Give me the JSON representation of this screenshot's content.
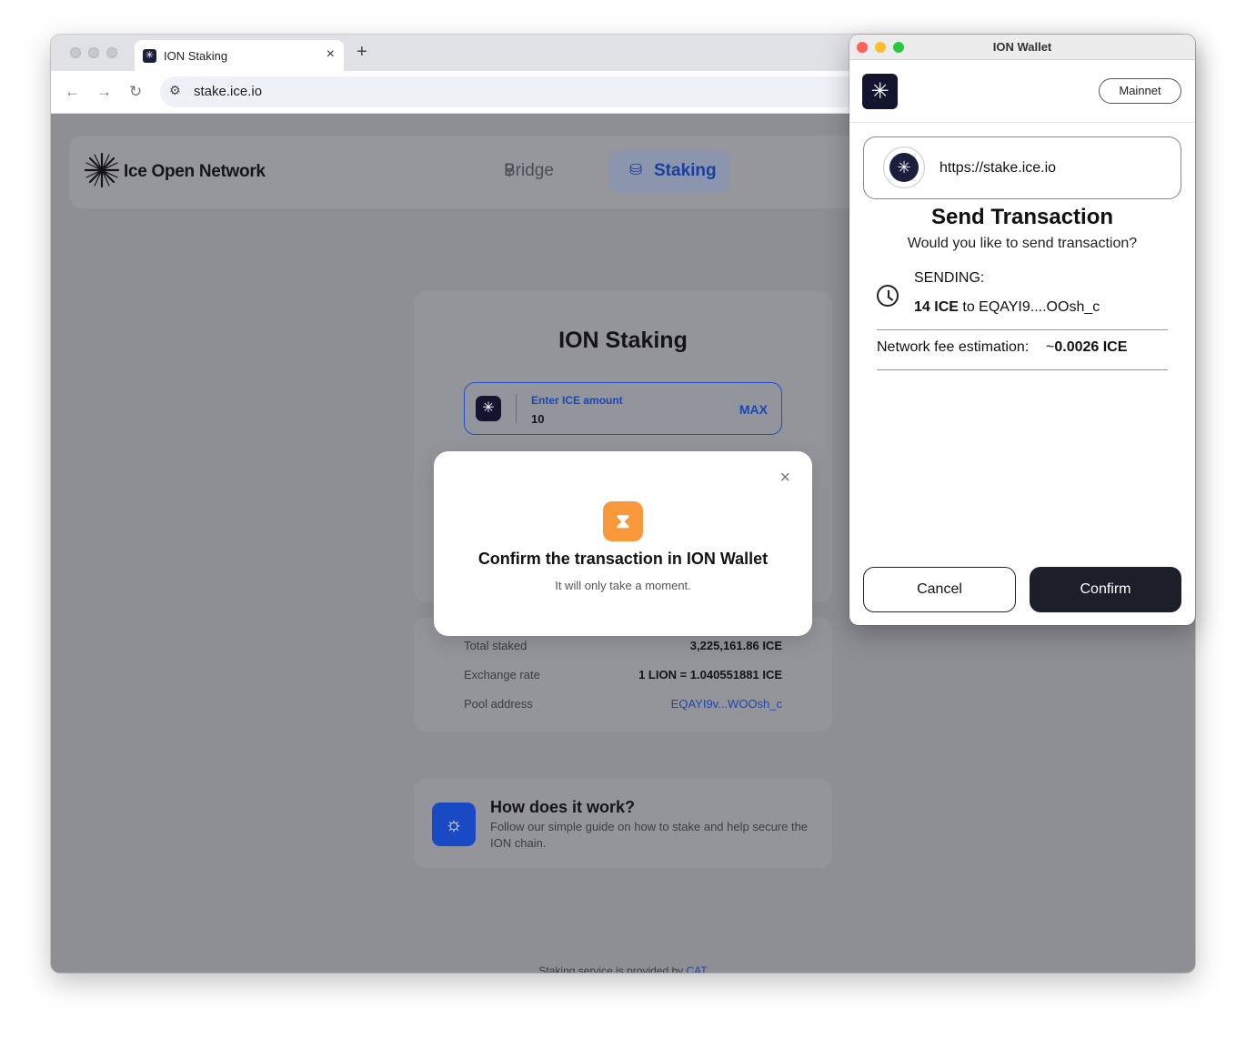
{
  "browser": {
    "tab_title": "ION Staking",
    "tab_favicon": "ion-logo-icon",
    "tab_close": "×",
    "new_tab": "+",
    "url": "stake.ice.io"
  },
  "site": {
    "brand": "Ice Open Network",
    "nav": {
      "bridge": "Bridge",
      "staking": "Staking"
    },
    "card_title": "ION Staking",
    "amount": {
      "label": "Enter ICE amount",
      "value": "10",
      "max": "MAX"
    },
    "stats": [
      {
        "key": "Total staked",
        "value": "3,225,161.86 ICE"
      },
      {
        "key": "Exchange rate",
        "value": "1 LION = 1.040551881 ICE"
      },
      {
        "key": "Pool address",
        "value": "EQAYI9v...WOOsh_c"
      }
    ],
    "how": {
      "title": "How does it work?",
      "description": "Follow our simple guide on how to stake and help secure the ION chain."
    },
    "footer": {
      "text": "Staking service is provided by ",
      "link": "CAT"
    }
  },
  "modal": {
    "title": "Confirm the transaction in ION Wallet",
    "subtitle": "It will only take a moment.",
    "close": "×"
  },
  "wallet": {
    "window_title": "ION Wallet",
    "network": "Mainnet",
    "origin_url": "https://stake.ice.io",
    "heading": "Send Transaction",
    "question": "Would you like to send transaction?",
    "sending_label": "SENDING:",
    "amount": "14 ICE",
    "to_text": " to EQAYI9....OOsh_c",
    "fee_label": "Network fee estimation:",
    "fee_value": "0.0026 ICE",
    "fee_prefix": "~",
    "cancel": "Cancel",
    "confirm": "Confirm"
  },
  "colors": {
    "accent_blue": "#1c46b3",
    "modal_icon": "#f7993a",
    "confirm_button": "#1b1f29"
  }
}
